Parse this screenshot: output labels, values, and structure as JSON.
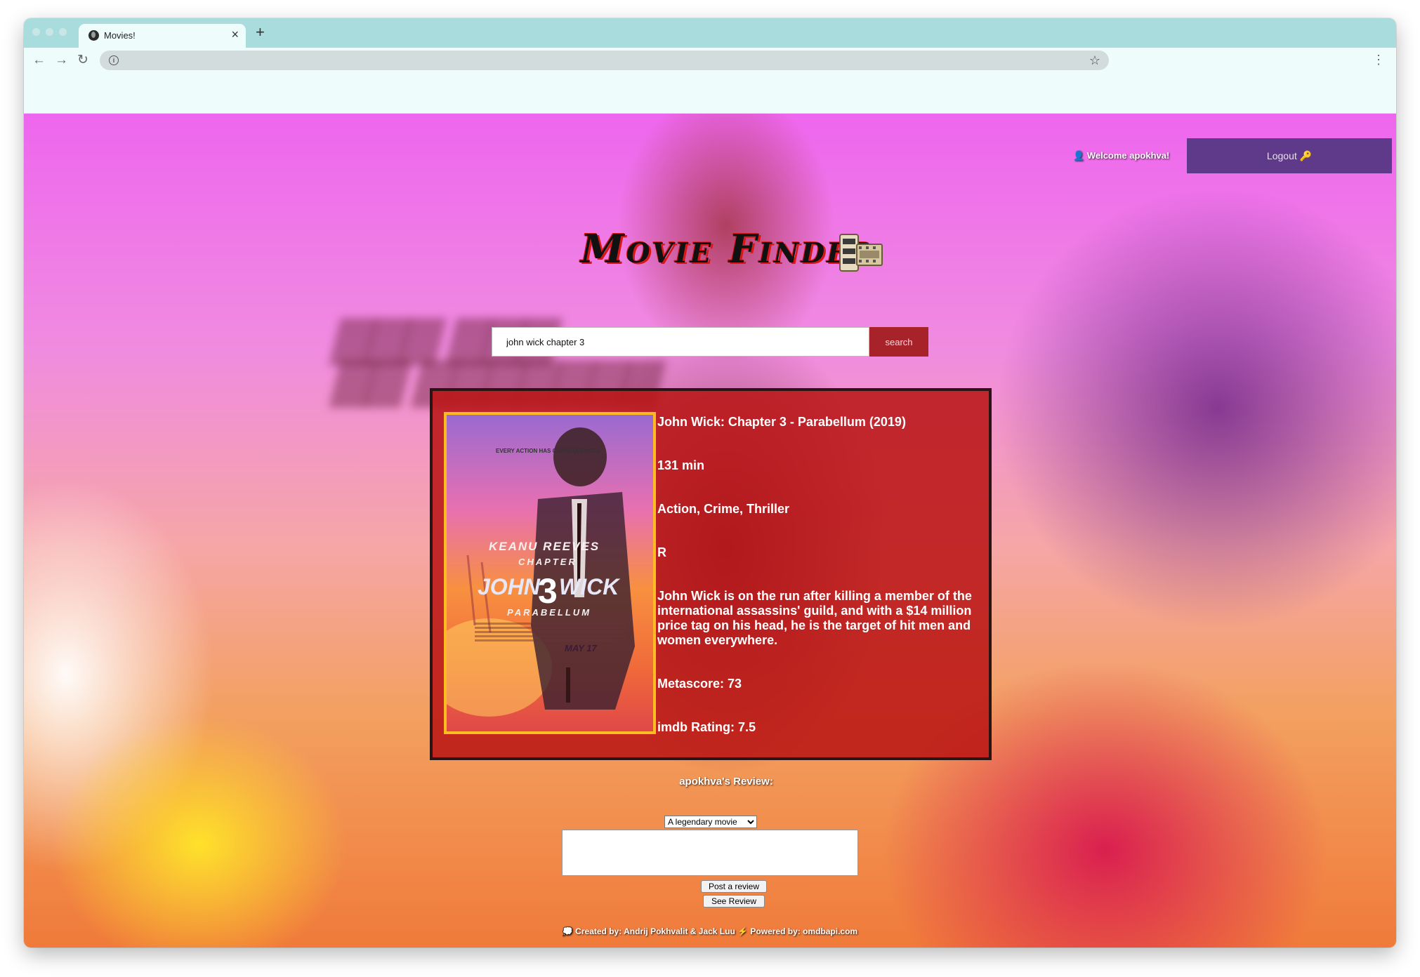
{
  "browser": {
    "tab_title": "Movies!",
    "new_tab_icon": "+",
    "close_tab_icon": "×",
    "address_value": ""
  },
  "header": {
    "welcome_icon": "👤",
    "welcome_text": "Welcome apokhva!",
    "logout_label": "Logout 🔑"
  },
  "logo": {
    "title": "Movie Finder",
    "icon": "film-reel-icon"
  },
  "search": {
    "value": "john wick chapter 3",
    "button_label": "search"
  },
  "movie": {
    "title": "John Wick: Chapter 3 - Parabellum (2019)",
    "runtime": "131 min",
    "genre": "Action, Crime, Thriller",
    "rated": "R",
    "plot": "John Wick is on the run after killing a member of the international assassins' guild, and with a $14 million price tag on his head, he is the target of hit men and women everywhere.",
    "metascore": "Metascore: 73",
    "imdb_rating": "imdb Rating: 7.5",
    "poster": {
      "tagline": "EVERY ACTION HAS CONSEQUENCES.",
      "actor": "KEANU REEVES",
      "chapter": "CHAPTER",
      "title_left": "JOHN",
      "number": "3",
      "title_right": "WICK",
      "subtitle": "PARABELLUM",
      "date": "MAY 17"
    }
  },
  "review": {
    "title": "apokhva's Review:",
    "selected_option": "A legendary movie",
    "post_label": "Post a review",
    "see_label": "See Review"
  },
  "footer": {
    "text": "💭 Created by: Andrij Pokhvalit & Jack Luu ⚡ Powered by: omdbapi.com"
  }
}
